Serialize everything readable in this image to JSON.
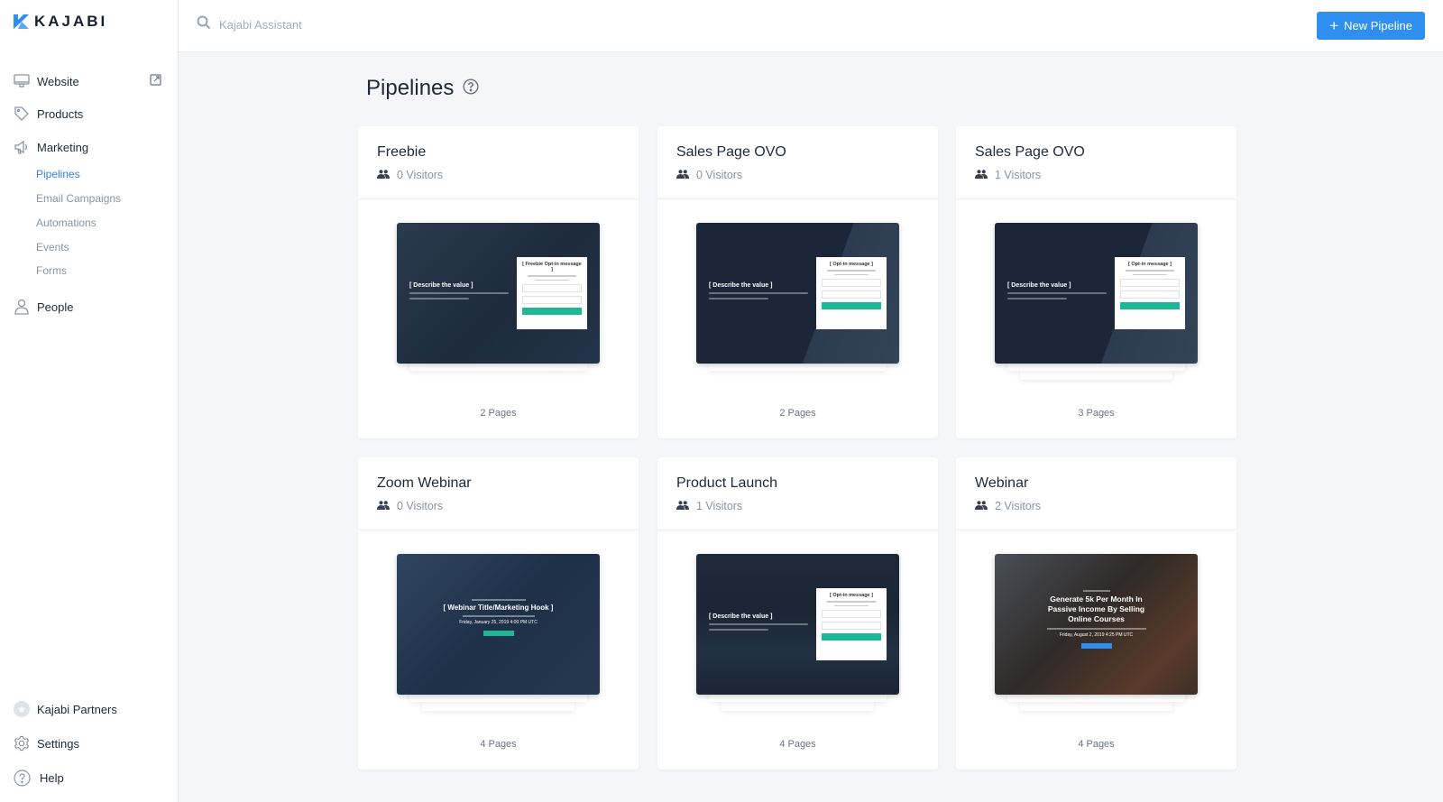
{
  "brand": {
    "name": "KAJABI",
    "accent": "#2f8ff0"
  },
  "sidebar": {
    "items": [
      {
        "label": "Website",
        "icon": "monitor-icon",
        "external": true
      },
      {
        "label": "Products",
        "icon": "tag-icon"
      },
      {
        "label": "Marketing",
        "icon": "megaphone-icon"
      },
      {
        "label": "People",
        "icon": "person-icon"
      }
    ],
    "marketing_sub": [
      {
        "label": "Pipelines",
        "active": true
      },
      {
        "label": "Email Campaigns"
      },
      {
        "label": "Automations"
      },
      {
        "label": "Events"
      },
      {
        "label": "Forms"
      }
    ],
    "bottom": [
      {
        "label": "Kajabi Partners",
        "icon": "star-badge-icon"
      },
      {
        "label": "Settings",
        "icon": "gear-icon"
      },
      {
        "label": "Help",
        "icon": "help-circle-icon"
      }
    ]
  },
  "topbar": {
    "search_placeholder": "Kajabi Assistant",
    "new_button_label": "New Pipeline"
  },
  "main": {
    "title": "Pipelines",
    "pipelines": [
      {
        "title": "Freebie",
        "visitors": "0 Visitors",
        "pages": "2 Pages",
        "preview": {
          "kind": "optin",
          "heading": "[ Describe the value ]",
          "form_title": "[ Freebie Opt-in message ]"
        }
      },
      {
        "title": "Sales Page OVO",
        "visitors": "0 Visitors",
        "pages": "2 Pages",
        "preview": {
          "kind": "optin",
          "heading": "[ Describe the value ]",
          "form_title": "[ Opt-in message ]"
        }
      },
      {
        "title": "Sales Page OVO",
        "visitors": "1 Visitors",
        "pages": "3 Pages",
        "preview": {
          "kind": "optin",
          "heading": "[ Describe the value ]",
          "form_title": "[ Opt-in message ]"
        }
      },
      {
        "title": "Zoom Webinar",
        "visitors": "0 Visitors",
        "pages": "4 Pages",
        "preview": {
          "kind": "webinar",
          "heading": "[ Webinar Title/Marketing Hook ]",
          "date": "Friday, January 25, 2019 4:00 PM UTC"
        }
      },
      {
        "title": "Product Launch",
        "visitors": "1 Visitors",
        "pages": "4 Pages",
        "preview": {
          "kind": "optin",
          "heading": "[ Describe the value ]",
          "form_title": "[ Opt-in message ]"
        }
      },
      {
        "title": "Webinar",
        "visitors": "2 Visitors",
        "pages": "4 Pages",
        "preview": {
          "kind": "webinar2",
          "heading": "Generate 5k Per Month In Passive Income By Selling Online Courses",
          "date": "Friday, August 2, 2019 4:25 PM UTC"
        }
      }
    ]
  }
}
